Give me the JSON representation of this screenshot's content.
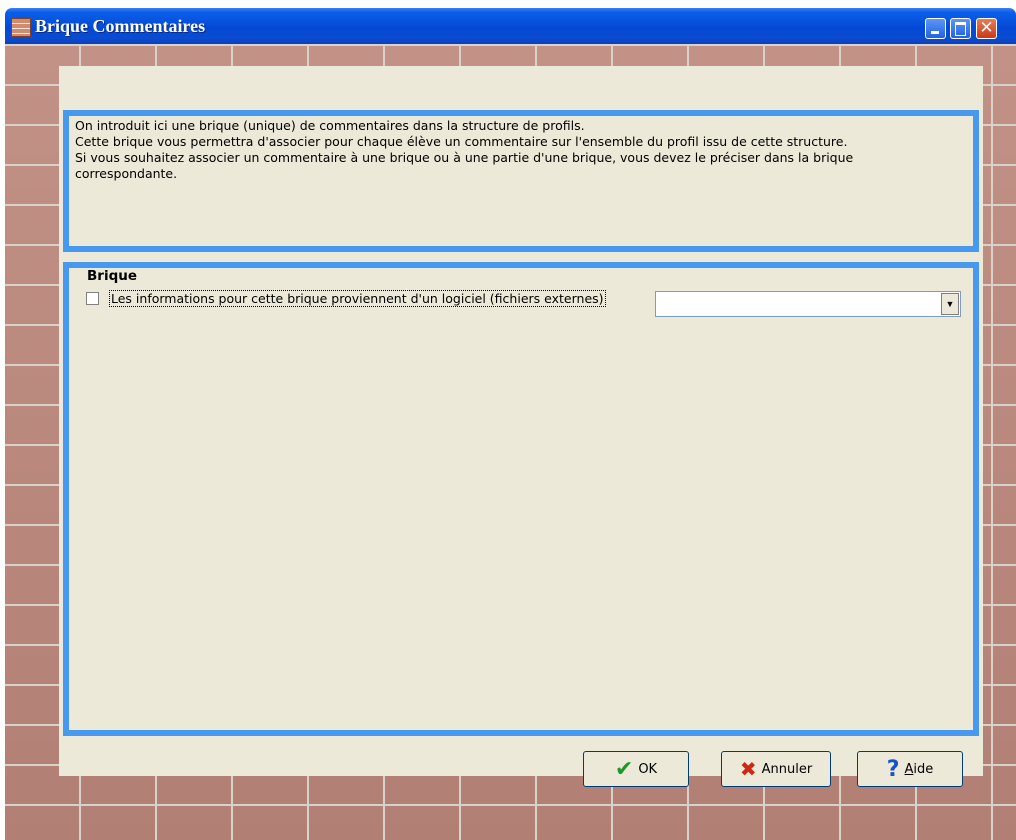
{
  "window": {
    "title": "Brique Commentaires",
    "controls": {
      "minimize": "minimize",
      "maximize": "maximize",
      "close": "✕"
    }
  },
  "info": {
    "lines": [
      "On introduit ici une brique (unique) de commentaires dans la structure de profils.",
      "Cette brique vous permettra d'associer pour chaque élève un commentaire sur l'ensemble du profil issu de cette structure.",
      "Si vous souhaitez associer un commentaire à une brique ou à une partie d'une brique, vous devez le préciser dans la brique",
      "correspondante."
    ]
  },
  "brique": {
    "title": "Brique",
    "checkbox_label": "Les informations pour cette brique proviennent d'un logiciel (fichiers externes)",
    "checkbox_checked": false,
    "combo_value": "",
    "combo_arrow": "▼"
  },
  "buttons": {
    "ok": {
      "label": "OK",
      "icon": "✔"
    },
    "cancel": {
      "label": "Annuler",
      "icon": "✖"
    },
    "help": {
      "label_first": "A",
      "label_rest": "ide",
      "icon": "?"
    }
  },
  "colors": {
    "titlebar": "#0449d6",
    "panel": "#ece9d8",
    "frame_border": "#4799f0",
    "brick": "#b98679",
    "mortar": "#d9d2ca"
  }
}
